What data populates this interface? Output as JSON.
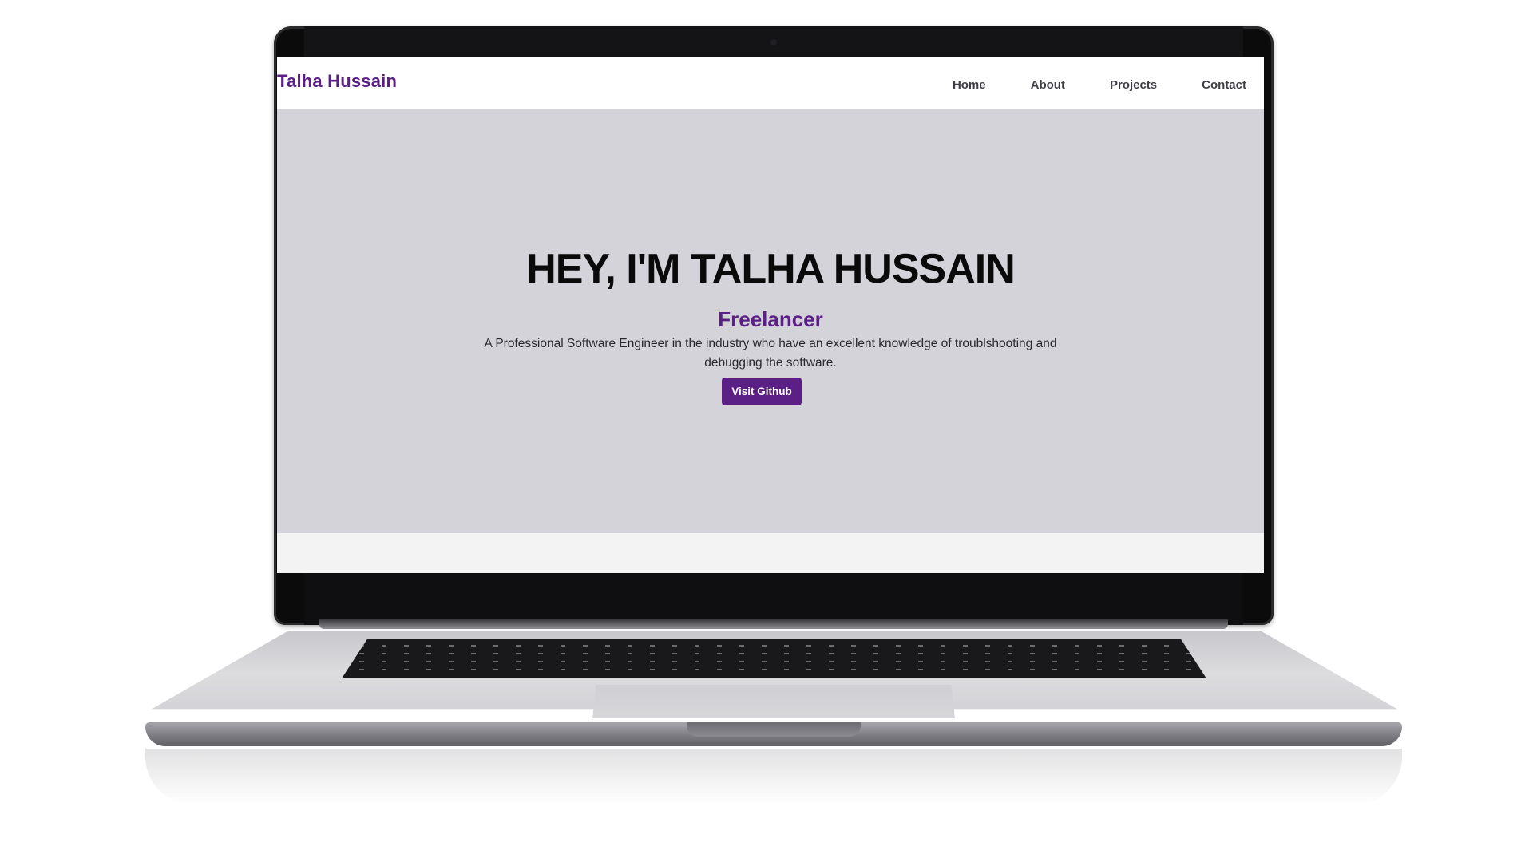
{
  "site": {
    "brand": "Talha Hussain",
    "nav": {
      "items": [
        "Home",
        "About",
        "Projects",
        "Contact"
      ]
    }
  },
  "hero": {
    "title": "HEY, I'M TALHA HUSSAIN",
    "subtitle": "Freelancer",
    "description": "A Professional Software Engineer in the industry who have an excellent knowledge of troublshooting and debugging the software.",
    "cta_label": "Visit Github"
  },
  "colors": {
    "accent": "#5b1f86",
    "hero_bg": "#d4d3d9",
    "nav_bg": "#ffffff",
    "footer_bg": "#f4f3f4"
  }
}
